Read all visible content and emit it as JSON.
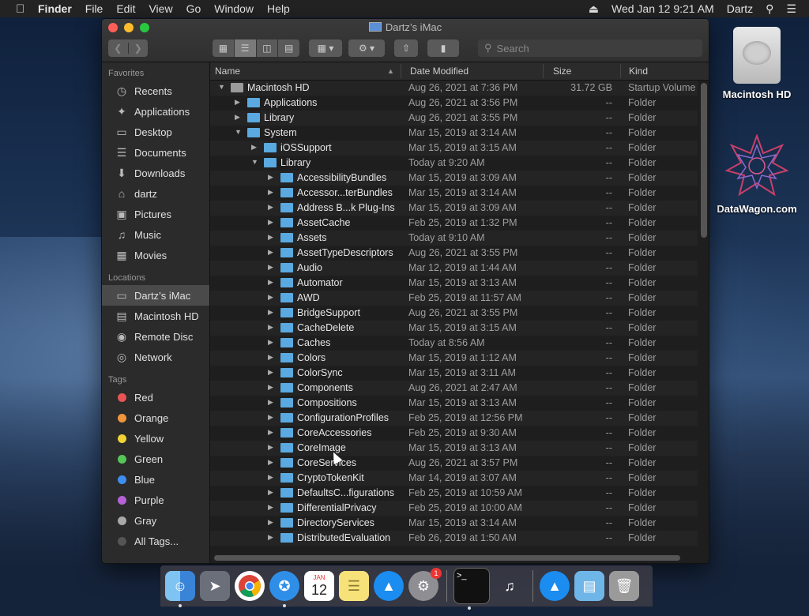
{
  "menubar": {
    "app": "Finder",
    "items": [
      "File",
      "Edit",
      "View",
      "Go",
      "Window",
      "Help"
    ],
    "datetime": "Wed Jan 12  9:21 AM",
    "user": "Dartz"
  },
  "window": {
    "title": "Dartz’s iMac",
    "search_placeholder": "Search"
  },
  "sidebar": {
    "favorites_label": "Favorites",
    "favorites": [
      {
        "label": "Recents",
        "icon": "clock-icon"
      },
      {
        "label": "Applications",
        "icon": "applications-icon"
      },
      {
        "label": "Desktop",
        "icon": "desktop-icon"
      },
      {
        "label": "Documents",
        "icon": "document-icon"
      },
      {
        "label": "Downloads",
        "icon": "download-icon"
      },
      {
        "label": "dartz",
        "icon": "home-icon"
      },
      {
        "label": "Pictures",
        "icon": "camera-icon"
      },
      {
        "label": "Music",
        "icon": "music-icon"
      },
      {
        "label": "Movies",
        "icon": "film-icon"
      }
    ],
    "locations_label": "Locations",
    "locations": [
      {
        "label": "Dartz’s iMac",
        "icon": "imac-icon",
        "selected": true
      },
      {
        "label": "Macintosh HD",
        "icon": "harddisk-icon"
      },
      {
        "label": "Remote Disc",
        "icon": "disc-icon"
      },
      {
        "label": "Network",
        "icon": "globe-icon"
      }
    ],
    "tags_label": "Tags",
    "tags": [
      {
        "label": "Red",
        "color": "#e85454"
      },
      {
        "label": "Orange",
        "color": "#f0953a"
      },
      {
        "label": "Yellow",
        "color": "#f2d335"
      },
      {
        "label": "Green",
        "color": "#56c558"
      },
      {
        "label": "Blue",
        "color": "#3e8ef0"
      },
      {
        "label": "Purple",
        "color": "#b462d6"
      },
      {
        "label": "Gray",
        "color": "#a8a8a8"
      },
      {
        "label": "All Tags...",
        "color": "#555555"
      }
    ]
  },
  "columns": {
    "name": "Name",
    "date": "Date Modified",
    "size": "Size",
    "kind": "Kind"
  },
  "rows": [
    {
      "name": "Macintosh HD",
      "date": "Aug 26, 2021 at 7:36 PM",
      "size": "31.72 GB",
      "kind": "Startup Volume",
      "level": 0,
      "open": true,
      "hd": true
    },
    {
      "name": "Applications",
      "date": "Aug 26, 2021 at 3:56 PM",
      "size": "--",
      "kind": "Folder",
      "level": 1,
      "open": false
    },
    {
      "name": "Library",
      "date": "Aug 26, 2021 at 3:55 PM",
      "size": "--",
      "kind": "Folder",
      "level": 1,
      "open": false
    },
    {
      "name": "System",
      "date": "Mar 15, 2019 at 3:14 AM",
      "size": "--",
      "kind": "Folder",
      "level": 1,
      "open": true
    },
    {
      "name": "iOSSupport",
      "date": "Mar 15, 2019 at 3:15 AM",
      "size": "--",
      "kind": "Folder",
      "level": 2,
      "open": false
    },
    {
      "name": "Library",
      "date": "Today at 9:20 AM",
      "size": "--",
      "kind": "Folder",
      "level": 2,
      "open": true
    },
    {
      "name": "AccessibilityBundles",
      "date": "Mar 15, 2019 at 3:09 AM",
      "size": "--",
      "kind": "Folder",
      "level": 3,
      "open": false
    },
    {
      "name": "Accessor...terBundles",
      "date": "Mar 15, 2019 at 3:14 AM",
      "size": "--",
      "kind": "Folder",
      "level": 3,
      "open": false
    },
    {
      "name": "Address B...k Plug-Ins",
      "date": "Mar 15, 2019 at 3:09 AM",
      "size": "--",
      "kind": "Folder",
      "level": 3,
      "open": false
    },
    {
      "name": "AssetCache",
      "date": "Feb 25, 2019 at 1:32 PM",
      "size": "--",
      "kind": "Folder",
      "level": 3,
      "open": false
    },
    {
      "name": "Assets",
      "date": "Today at 9:10 AM",
      "size": "--",
      "kind": "Folder",
      "level": 3,
      "open": false
    },
    {
      "name": "AssetTypeDescriptors",
      "date": "Aug 26, 2021 at 3:55 PM",
      "size": "--",
      "kind": "Folder",
      "level": 3,
      "open": false
    },
    {
      "name": "Audio",
      "date": "Mar 12, 2019 at 1:44 AM",
      "size": "--",
      "kind": "Folder",
      "level": 3,
      "open": false
    },
    {
      "name": "Automator",
      "date": "Mar 15, 2019 at 3:13 AM",
      "size": "--",
      "kind": "Folder",
      "level": 3,
      "open": false
    },
    {
      "name": "AWD",
      "date": "Feb 25, 2019 at 11:57 AM",
      "size": "--",
      "kind": "Folder",
      "level": 3,
      "open": false
    },
    {
      "name": "BridgeSupport",
      "date": "Aug 26, 2021 at 3:55 PM",
      "size": "--",
      "kind": "Folder",
      "level": 3,
      "open": false
    },
    {
      "name": "CacheDelete",
      "date": "Mar 15, 2019 at 3:15 AM",
      "size": "--",
      "kind": "Folder",
      "level": 3,
      "open": false
    },
    {
      "name": "Caches",
      "date": "Today at 8:56 AM",
      "size": "--",
      "kind": "Folder",
      "level": 3,
      "open": false
    },
    {
      "name": "Colors",
      "date": "Mar 15, 2019 at 1:12 AM",
      "size": "--",
      "kind": "Folder",
      "level": 3,
      "open": false
    },
    {
      "name": "ColorSync",
      "date": "Mar 15, 2019 at 3:11 AM",
      "size": "--",
      "kind": "Folder",
      "level": 3,
      "open": false
    },
    {
      "name": "Components",
      "date": "Aug 26, 2021 at 2:47 AM",
      "size": "--",
      "kind": "Folder",
      "level": 3,
      "open": false
    },
    {
      "name": "Compositions",
      "date": "Mar 15, 2019 at 3:13 AM",
      "size": "--",
      "kind": "Folder",
      "level": 3,
      "open": false
    },
    {
      "name": "ConfigurationProfiles",
      "date": "Feb 25, 2019 at 12:56 PM",
      "size": "--",
      "kind": "Folder",
      "level": 3,
      "open": false
    },
    {
      "name": "CoreAccessories",
      "date": "Feb 25, 2019 at 9:30 AM",
      "size": "--",
      "kind": "Folder",
      "level": 3,
      "open": false
    },
    {
      "name": "CoreImage",
      "date": "Mar 15, 2019 at 3:13 AM",
      "size": "--",
      "kind": "Folder",
      "level": 3,
      "open": false
    },
    {
      "name": "CoreServices",
      "date": "Aug 26, 2021 at 3:57 PM",
      "size": "--",
      "kind": "Folder",
      "level": 3,
      "open": false
    },
    {
      "name": "CryptoTokenKit",
      "date": "Mar 14, 2019 at 3:07 AM",
      "size": "--",
      "kind": "Folder",
      "level": 3,
      "open": false
    },
    {
      "name": "DefaultsC...figurations",
      "date": "Feb 25, 2019 at 10:59 AM",
      "size": "--",
      "kind": "Folder",
      "level": 3,
      "open": false
    },
    {
      "name": "DifferentialPrivacy",
      "date": "Feb 25, 2019 at 10:00 AM",
      "size": "--",
      "kind": "Folder",
      "level": 3,
      "open": false
    },
    {
      "name": "DirectoryServices",
      "date": "Mar 15, 2019 at 3:14 AM",
      "size": "--",
      "kind": "Folder",
      "level": 3,
      "open": false
    },
    {
      "name": "DistributedEvaluation",
      "date": "Feb 26, 2019 at 1:50 AM",
      "size": "--",
      "kind": "Folder",
      "level": 3,
      "open": false
    }
  ],
  "desktop": {
    "hd_label": "Macintosh HD",
    "datawagon_label": "DataWagon.com"
  },
  "dock": {
    "calendar_month": "JAN",
    "calendar_day": "12",
    "badge": "1"
  }
}
